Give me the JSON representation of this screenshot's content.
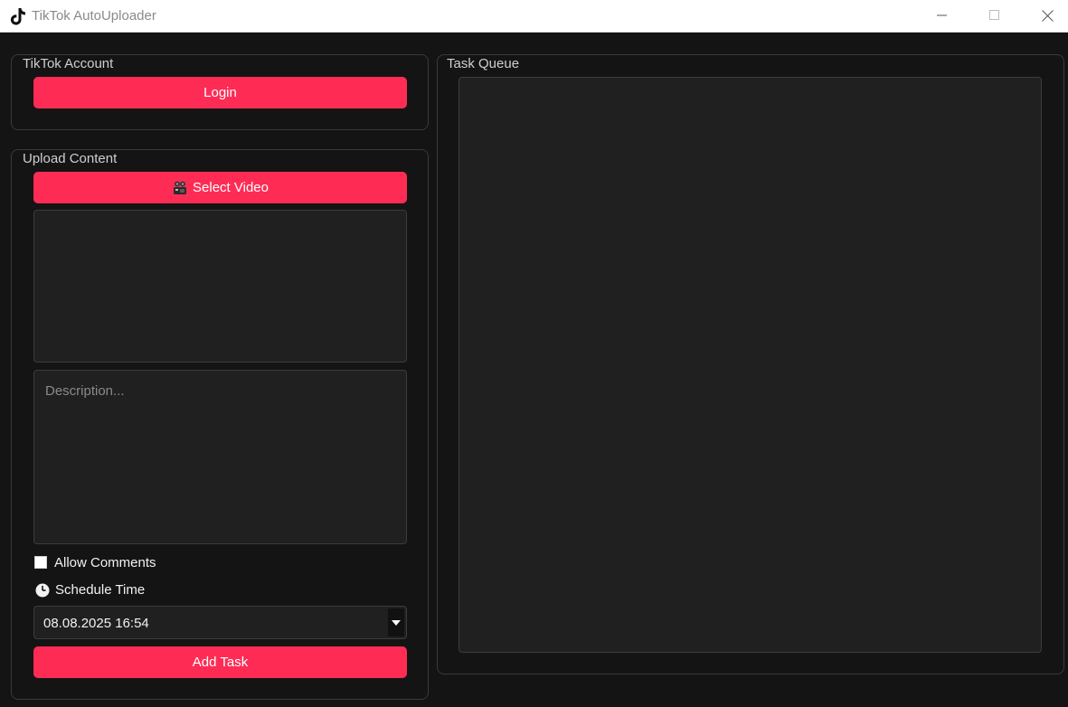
{
  "window": {
    "title": "TikTok AutoUploader"
  },
  "account": {
    "group_title": "TikTok Account",
    "login_label": "Login"
  },
  "upload": {
    "group_title": "Upload Content",
    "select_video_label": "Select Video",
    "select_video_icon": "film-projector-icon",
    "description_placeholder": "Description...",
    "allow_comments_label": "Allow Comments",
    "allow_comments_checked": false,
    "schedule_label": "Schedule Time",
    "schedule_value": "08.08.2025 16:54",
    "add_task_label": "Add Task"
  },
  "queue": {
    "group_title": "Task Queue",
    "items": []
  },
  "colors": {
    "accent": "#fe2c55",
    "background": "#141414",
    "field": "#202020"
  }
}
